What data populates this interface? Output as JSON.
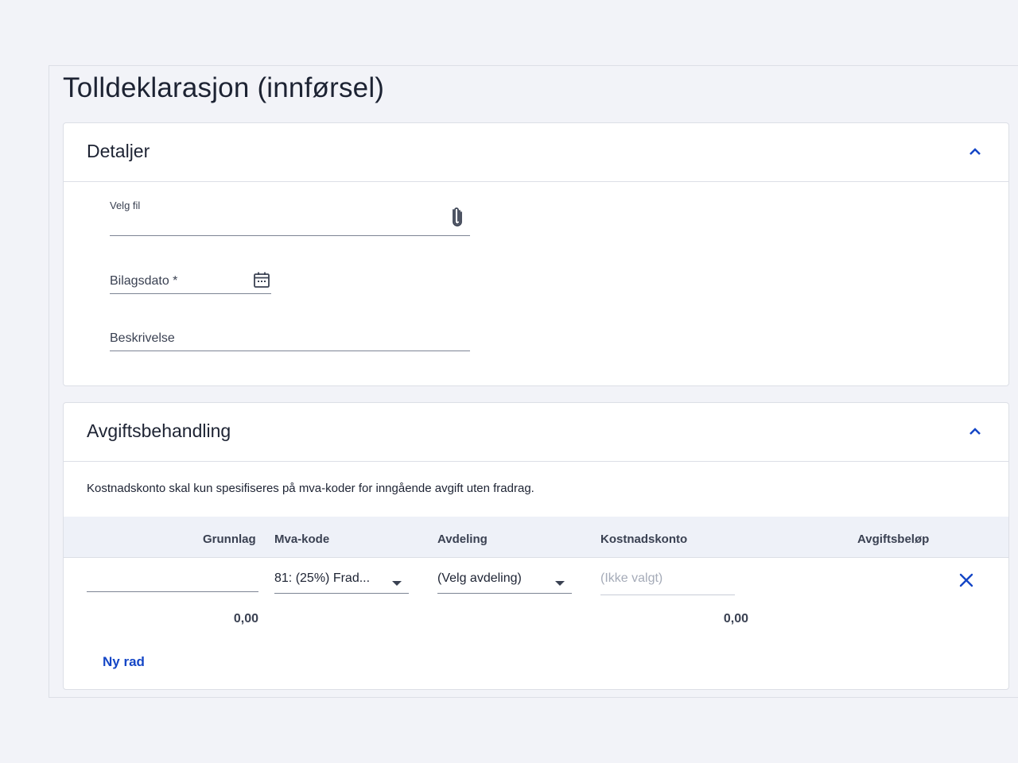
{
  "page": {
    "title": "Tolldeklarasjon (innførsel)"
  },
  "details": {
    "title": "Detaljer",
    "file_label": "Velg fil",
    "date_label": "Bilagsdato *",
    "description_label": "Beskrivelse"
  },
  "fees": {
    "title": "Avgiftsbehandling",
    "info": "Kostnadskonto skal kun spesifiseres på mva-koder for inngående avgift uten fradrag.",
    "columns": {
      "grunnlag": "Grunnlag",
      "mva": "Mva-kode",
      "avdeling": "Avdeling",
      "konto": "Kostnadskonto",
      "belop": "Avgiftsbeløp"
    },
    "row": {
      "grunnlag_value": "",
      "mva_value": "81: (25%) Frad...",
      "avdeling_value": "(Velg avdeling)",
      "konto_placeholder": "(Ikke valgt)"
    },
    "totals": {
      "grunnlag": "0,00",
      "belop": "0,00"
    },
    "new_row": "Ny rad"
  },
  "colors": {
    "accent": "#1446c6",
    "background": "#f2f3f8"
  },
  "icons": [
    "chevron-up-icon",
    "paperclip-icon",
    "calendar-icon",
    "chevron-down-icon",
    "close-icon"
  ]
}
